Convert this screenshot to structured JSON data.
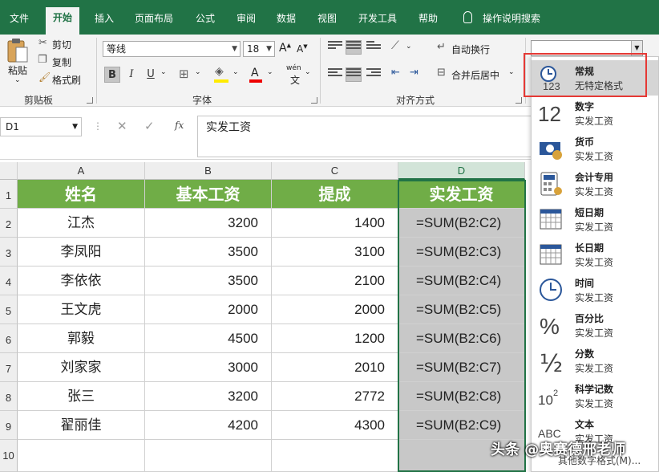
{
  "tabs": [
    "文件",
    "开始",
    "插入",
    "页面布局",
    "公式",
    "审阅",
    "数据",
    "视图",
    "开发工具",
    "帮助",
    "操作说明搜索"
  ],
  "ribbon": {
    "paste": "粘贴",
    "cut": "剪切",
    "copy": "复制",
    "format_painter": "格式刷",
    "clipboard_label": "剪贴板",
    "font_name": "等线",
    "font_size": "18",
    "font_label": "字体",
    "bold": "B",
    "italic": "I",
    "underline": "U",
    "phonetic": "wén",
    "wrap_text": "自动换行",
    "merge_center": "合并后居中",
    "align_label": "对齐方式"
  },
  "formula_bar": {
    "name_box": "D1",
    "fx": "fx",
    "content": "实发工资"
  },
  "columns": [
    "A",
    "B",
    "C",
    "D"
  ],
  "rows": [
    "1",
    "2",
    "3",
    "4",
    "5",
    "6",
    "7",
    "8",
    "9",
    "10"
  ],
  "table": {
    "headers": [
      "姓名",
      "基本工资",
      "提成",
      "实发工资"
    ],
    "rows": [
      [
        "江杰",
        "3200",
        "1400",
        "=SUM(B2:C2)"
      ],
      [
        "李凤阳",
        "3500",
        "3100",
        "=SUM(B2:C3)"
      ],
      [
        "李依依",
        "3500",
        "2100",
        "=SUM(B2:C4)"
      ],
      [
        "王文虎",
        "2000",
        "2000",
        "=SUM(B2:C5)"
      ],
      [
        "郭毅",
        "4500",
        "1200",
        "=SUM(B2:C6)"
      ],
      [
        "刘家家",
        "3000",
        "2010",
        "=SUM(B2:C7)"
      ],
      [
        "张三",
        "3200",
        "2772",
        "=SUM(B2:C8)"
      ],
      [
        "翟丽佳",
        "4200",
        "4300",
        "=SUM(B2:C9)"
      ]
    ]
  },
  "format_dropdown": {
    "items": [
      {
        "title": "常规",
        "sample": "无特定格式",
        "icon": "clock-123-icon"
      },
      {
        "title": "数字",
        "sample": "实发工资",
        "icon": "number-12-icon"
      },
      {
        "title": "货币",
        "sample": "实发工资",
        "icon": "currency-icon"
      },
      {
        "title": "会计专用",
        "sample": "实发工资",
        "icon": "calculator-icon"
      },
      {
        "title": "短日期",
        "sample": "实发工资",
        "icon": "calendar-icon"
      },
      {
        "title": "长日期",
        "sample": "实发工资",
        "icon": "calendar-icon"
      },
      {
        "title": "时间",
        "sample": "实发工资",
        "icon": "clock-icon"
      },
      {
        "title": "百分比",
        "sample": "实发工资",
        "icon": "percent-icon"
      },
      {
        "title": "分数",
        "sample": "实发工资",
        "icon": "fraction-icon"
      },
      {
        "title": "科学记数",
        "sample": "实发工资",
        "icon": "scientific-icon"
      },
      {
        "title": "文本",
        "sample": "实发工资",
        "icon": "abc-icon"
      }
    ],
    "more": "其他数字格式(M)..."
  },
  "watermark": "头条 @奥赛德邢老师",
  "colors": {
    "ribbon": "#217346",
    "header_fill": "#70ad47",
    "formula_fill": "#c8c8c8",
    "highlight": "#e53935"
  }
}
